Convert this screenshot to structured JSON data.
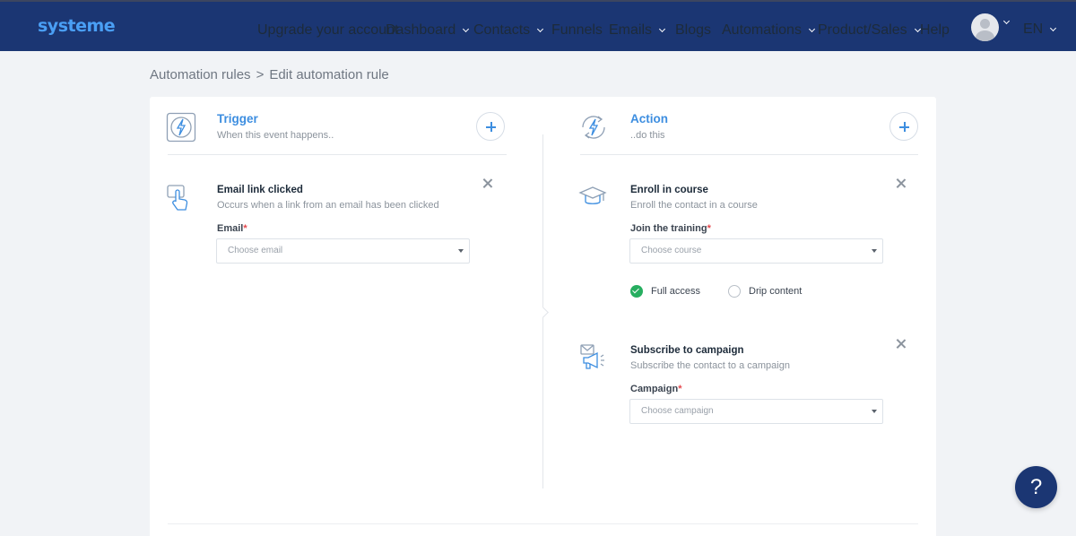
{
  "header": {
    "logo": "systeme",
    "nav": [
      {
        "label": "Upgrade your account",
        "has_caret": false
      },
      {
        "label": "Dashboard",
        "has_caret": true
      },
      {
        "label": "Contacts",
        "has_caret": true
      },
      {
        "label": "Funnels",
        "has_caret": false
      },
      {
        "label": "Emails",
        "has_caret": true
      },
      {
        "label": "Blogs",
        "has_caret": false
      },
      {
        "label": "Automations",
        "has_caret": true
      },
      {
        "label": "Product/Sales",
        "has_caret": true
      },
      {
        "label": "Help",
        "has_caret": false
      }
    ],
    "language": "EN"
  },
  "breadcrumb": {
    "parent": "Automation rules",
    "separator": ">",
    "current": "Edit automation rule"
  },
  "trigger": {
    "title": "Trigger",
    "subtitle": "When this event happens..",
    "item": {
      "title": "Email link clicked",
      "description": "Occurs when a link from an email has been clicked",
      "field_label": "Email",
      "required_mark": "*",
      "placeholder": "Choose email"
    }
  },
  "action": {
    "title": "Action",
    "subtitle": "..do this",
    "items": [
      {
        "title": "Enroll in course",
        "description": "Enroll the contact in a course",
        "field_label": "Join the training",
        "required_mark": "*",
        "placeholder": "Choose course",
        "options": [
          {
            "label": "Full access",
            "selected": true
          },
          {
            "label": "Drip content",
            "selected": false
          }
        ]
      },
      {
        "title": "Subscribe to campaign",
        "description": "Subscribe the contact to a campaign",
        "field_label": "Campaign",
        "required_mark": "*",
        "placeholder": "Choose campaign"
      }
    ]
  },
  "help_button": "?",
  "colors": {
    "topbar": "#1b3673",
    "logo": "#4a9ff5",
    "accent": "#3d8ee0",
    "success": "#27ae60",
    "required": "#e5484d"
  },
  "icons": {
    "trigger": "lightning-square-icon",
    "action": "lightning-refresh-icon",
    "email_link": "hand-click-icon",
    "course": "graduation-cap-icon",
    "campaign": "megaphone-mail-icon"
  }
}
